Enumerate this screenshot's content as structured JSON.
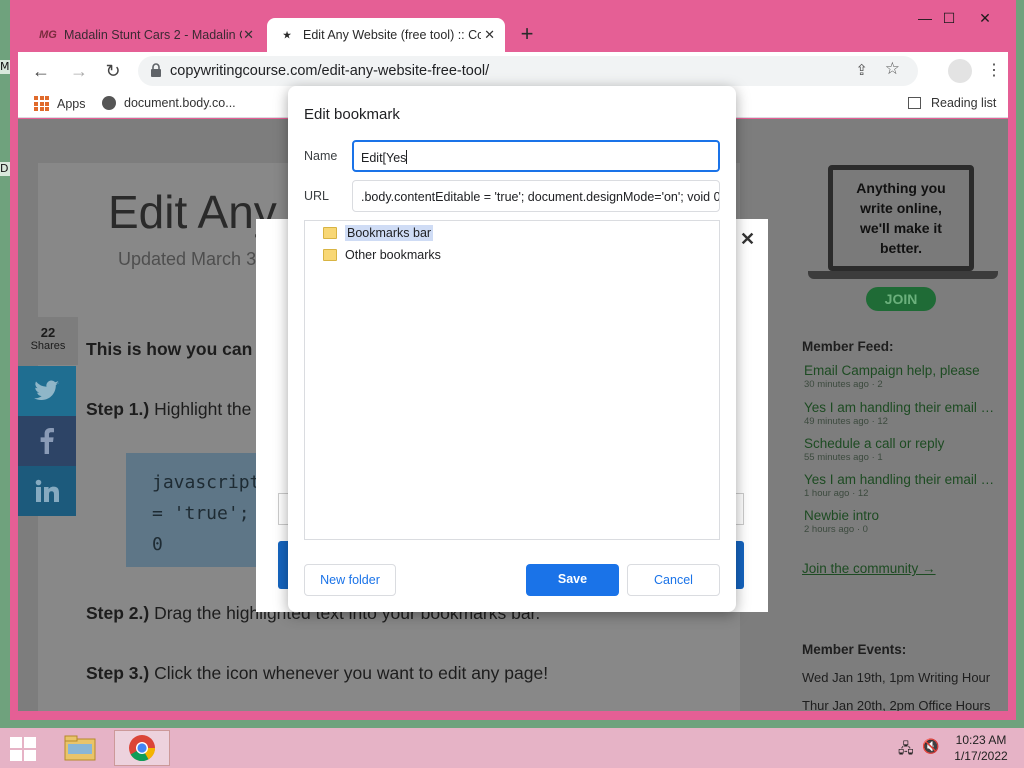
{
  "browser": {
    "tabs": [
      {
        "label": "Madalin Stunt Cars 2 - Madalin C",
        "favicon": "MG"
      },
      {
        "label": "Edit Any Website (free tool) :: Co"
      }
    ],
    "address": "copywritingcourse.com/edit-any-website-free-tool/",
    "bookmarks": {
      "apps": "Apps",
      "item1": "document.body.co...",
      "reading_list": "Reading list"
    }
  },
  "page": {
    "title": "Edit Any",
    "updated": "Updated March 3",
    "intro": "This is how you can",
    "step1_bold": "Step 1.)",
    "step1_text": "Highlight the",
    "code_lines": [
      "javascript",
      "= 'true';",
      "0"
    ],
    "step2_bold": "Step 2.)",
    "step2_text": "Drag the highlighted text into your bookmarks bar.",
    "step3_bold": "Step 3.)",
    "step3_text": "Click the icon whenever you want to edit any page!",
    "shares_count": "22",
    "shares_label": "Shares"
  },
  "sidebar": {
    "ad_text": [
      "Anything you",
      "write online,",
      "we'll make it",
      "better."
    ],
    "join": "JOIN",
    "feed_heading": "Member Feed:",
    "feed": [
      {
        "title": "Email Campaign help, please",
        "meta": "30 minutes ago · 2"
      },
      {
        "title": "Yes I am handling their email m...",
        "meta": "49 minutes ago · 12"
      },
      {
        "title": "Schedule a call or reply",
        "meta": "55 minutes ago · 1"
      },
      {
        "title": "Yes I am handling their email m...",
        "meta": "1 hour ago · 12"
      },
      {
        "title": "Newbie intro",
        "meta": "2 hours ago · 0"
      }
    ],
    "community": "Join the community →",
    "events_heading": "Member Events:",
    "events": [
      "Wed Jan 19th, 1pm Writing Hour",
      "Thur Jan 20th, 2pm Office Hours"
    ]
  },
  "dialog": {
    "title": "Edit bookmark",
    "name_label": "Name",
    "name_value": "Edit[Yes",
    "url_label": "URL",
    "url_value": ".body.contentEditable = 'true'; document.designMode='on'; void 0",
    "folders": [
      "Bookmarks bar",
      "Other bookmarks"
    ],
    "new_folder": "New folder",
    "save": "Save",
    "cancel": "Cancel"
  },
  "taskbar": {
    "time": "10:23 AM",
    "date": "1/17/2022"
  },
  "colors": {
    "accent": "#1a73e8",
    "window_frame": "#e55f95",
    "link_green": "#1d4b22"
  }
}
